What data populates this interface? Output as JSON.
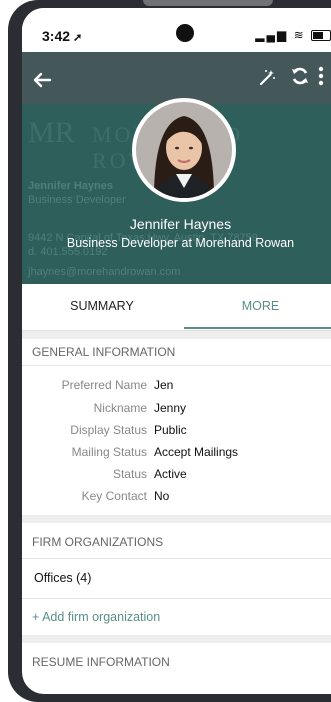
{
  "status_bar": {
    "time": "3:42",
    "location_glyph": "➚",
    "signal": "▂▄▆",
    "wifi": "≋"
  },
  "header": {
    "back_icon": "arrow-left",
    "actions": [
      "magic-wand",
      "sync",
      "more-vertical"
    ],
    "background_card": {
      "logo_initials": "MR",
      "logo_name": "MOREHAND ROWAN",
      "line1": "Jennifer Haynes",
      "line2": "Business Developer",
      "line3": "9442 N Capital of Texas Hwy, Austin, TX 78759",
      "line4": "d. 401.555.0192",
      "line5": "jhaynes@morehandrowan.com"
    },
    "name": "Jennifer Haynes",
    "title": "Business Developer at Morehand Rowan"
  },
  "tabs": [
    {
      "label": "SUMMARY",
      "active": false
    },
    {
      "label": "MORE",
      "active": true
    }
  ],
  "general_information": {
    "heading": "GENERAL INFORMATION",
    "rows": [
      {
        "label": "Preferred Name",
        "value": "Jen"
      },
      {
        "label": "Nickname",
        "value": "Jenny"
      },
      {
        "label": "Display Status",
        "value": "Public"
      },
      {
        "label": "Mailing Status",
        "value": "Accept Mailings"
      },
      {
        "label": "Status",
        "value": "Active"
      },
      {
        "label": "Key Contact",
        "value": "No"
      }
    ]
  },
  "firm_organizations": {
    "heading": "FIRM ORGANIZATIONS",
    "offices": "Offices (4)",
    "add_link": "+ Add firm organization"
  },
  "resume_information": {
    "heading": "RESUME INFORMATION"
  },
  "colors": {
    "accent": "#5c8e88",
    "header_bg": "#44585a",
    "card_bg": "#2f5f5b"
  }
}
